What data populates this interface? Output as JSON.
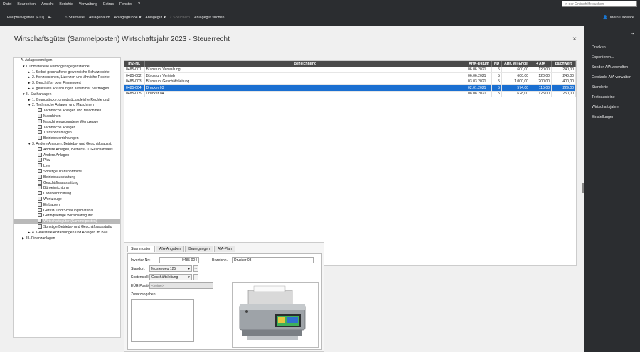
{
  "menubar": {
    "items": [
      "Datei",
      "Bearbeiten",
      "Ansicht",
      "Berichte",
      "Verwaltung",
      "Extras",
      "Fenster",
      "?"
    ],
    "help_placeholder": "In der Onlinehilfe suchen"
  },
  "toolbar": {
    "nav_label": "Hauptnavigation [F10]",
    "start_label": "Startseite",
    "anlagebaum_label": "Anlagebaum",
    "anlagegruppe_label": "Anlagegruppe",
    "anlagegut_label": "Anlagegut",
    "speichern_label": "Speichern",
    "suchen_label": "Anlagegut suchen",
    "user_label": "Mein Lexware"
  },
  "page": {
    "title": "Wirtschaftsgüter (Sammelposten)   Wirtschaftsjahr   2023  ·  Steuerrecht"
  },
  "tree": [
    {
      "text": "A. Anlagevermögen",
      "indent": 0,
      "arrow": ""
    },
    {
      "text": "I. Immaterielle Vermögensgegenstände",
      "indent": 1,
      "arrow": "▼"
    },
    {
      "text": "1. Selbst geschaffene gewerbliche Schutzrechte",
      "indent": 2,
      "arrow": "▶"
    },
    {
      "text": "2. Konzessionen, Lizenzen und ähnliche Rechte",
      "indent": 2,
      "arrow": "▶"
    },
    {
      "text": "3. Geschäfts- oder Firmenwert",
      "indent": 2,
      "arrow": "▶"
    },
    {
      "text": "4. geleistete Anzahlungen auf immat. Vermögen",
      "indent": 2,
      "arrow": "▶"
    },
    {
      "text": "II. Sachanlagen",
      "indent": 1,
      "arrow": "▼"
    },
    {
      "text": "1. Grundstücke, grundstücksgleiche Rechte und",
      "indent": 2,
      "arrow": "▶"
    },
    {
      "text": "2. Technische Anlagen und Maschinen",
      "indent": 2,
      "arrow": "▼"
    },
    {
      "text": "Technische Anlagen und Maschinen",
      "indent": 3,
      "arrow": "",
      "icon": true
    },
    {
      "text": "Maschinen",
      "indent": 3,
      "arrow": "",
      "icon": true
    },
    {
      "text": "Maschinengebundene Werkzeuge",
      "indent": 3,
      "arrow": "",
      "icon": true
    },
    {
      "text": "Technische Anlagen",
      "indent": 3,
      "arrow": "",
      "icon": true
    },
    {
      "text": "Transportanlagen",
      "indent": 3,
      "arrow": "",
      "icon": true
    },
    {
      "text": "Betriebsvorrichtungen",
      "indent": 3,
      "arrow": "",
      "icon": true
    },
    {
      "text": "3. Andere Anlagen, Betriebs- und Geschäftsausst.",
      "indent": 2,
      "arrow": "▼"
    },
    {
      "text": "Andere Anlagen, Betriebs- u. Geschäftsaus",
      "indent": 3,
      "arrow": "",
      "icon": true
    },
    {
      "text": "Andere Anlagen",
      "indent": 3,
      "arrow": "",
      "icon": true
    },
    {
      "text": "Pkw",
      "indent": 3,
      "arrow": "",
      "icon": true
    },
    {
      "text": "Lkw",
      "indent": 3,
      "arrow": "",
      "icon": true
    },
    {
      "text": "Sonstige Transportmittel",
      "indent": 3,
      "arrow": "",
      "icon": true
    },
    {
      "text": "Betriebsausstattung",
      "indent": 3,
      "arrow": "",
      "icon": true
    },
    {
      "text": "Geschäftsausstattung",
      "indent": 3,
      "arrow": "",
      "icon": true
    },
    {
      "text": "Büroeinrichtung",
      "indent": 3,
      "arrow": "",
      "icon": true
    },
    {
      "text": "Ladeneinrichtung",
      "indent": 3,
      "arrow": "",
      "icon": true
    },
    {
      "text": "Werkzeuge",
      "indent": 3,
      "arrow": "",
      "icon": true
    },
    {
      "text": "Einbauten",
      "indent": 3,
      "arrow": "",
      "icon": true
    },
    {
      "text": "Gerüst- und Schalungsmaterial",
      "indent": 3,
      "arrow": "",
      "icon": true
    },
    {
      "text": "Geringwertige Wirtschaftsgüter",
      "indent": 3,
      "arrow": "",
      "icon": true
    },
    {
      "text": "Wirtschaftsgüter (Sammelposten)",
      "indent": 3,
      "arrow": "",
      "icon": true,
      "selected": true
    },
    {
      "text": "Sonstige Betriebs- und Geschäftsausstattu",
      "indent": 3,
      "arrow": "",
      "icon": true
    },
    {
      "text": "4. Geleistete Anzahlungen und Anlagen im Bau",
      "indent": 2,
      "arrow": "▶"
    },
    {
      "text": "III. Finanzanlagen",
      "indent": 1,
      "arrow": "▶"
    }
  ],
  "table": {
    "columns": [
      "Inv.-Nr.",
      "Bezeichnung",
      "AHK-Datum",
      "ND",
      "AHK Wj-Ende",
      "+ AfA",
      "Buchwert"
    ],
    "rows": [
      [
        "0485-001",
        "Bürostuhl Verwaltung",
        "06.06.2021",
        "5",
        "600,00",
        "120,00",
        "240,00"
      ],
      [
        "0485-002",
        "Bürostuhl Vertrieb",
        "06.06.2021",
        "5",
        "600,00",
        "120,00",
        "240,00"
      ],
      [
        "0485-003",
        "Bürostuhl Geschäftsleitung",
        "03.03.2021",
        "5",
        "1.000,00",
        "200,00",
        "400,00"
      ],
      [
        "0485-004",
        "Drucker 03",
        "02.01.2021",
        "5",
        "574,00",
        "115,00",
        "229,00"
      ],
      [
        "0485-005",
        "Drucker 04",
        "08.08.2021",
        "5",
        "628,00",
        "125,00",
        "250,00"
      ]
    ],
    "selected_index": 3
  },
  "detail": {
    "tabs": [
      "Stammdaten",
      "AfA-Angaben",
      "Bewegungen",
      "AfA-Plan"
    ],
    "inventar_label": "Inventar-Nr.:",
    "inventar_value": "0485-004",
    "bezeichnung_label": "Bezeichn.:",
    "bezeichnung_value": "Drucker 03",
    "standort_label": "Standort:",
    "standort_value": "Musterweg 125",
    "kostenstelle_label": "Kostenstelle:",
    "kostenstelle_value": "Geschäftsleitung",
    "eur_label": "EÜR-Position:",
    "eur_value": "<keine>",
    "zusatz_label": "Zusatzangaben:",
    "dots": "...",
    "printer_icon": "printer-image"
  },
  "sidebar": {
    "items": [
      "Drucken...",
      "Exportieren...",
      "Sonder-AfA verwalten",
      "Gebäude-AfA verwalten",
      "Standorte",
      "Textbausteine",
      "Wirtschaftsjahre",
      "Einstellungen"
    ]
  }
}
